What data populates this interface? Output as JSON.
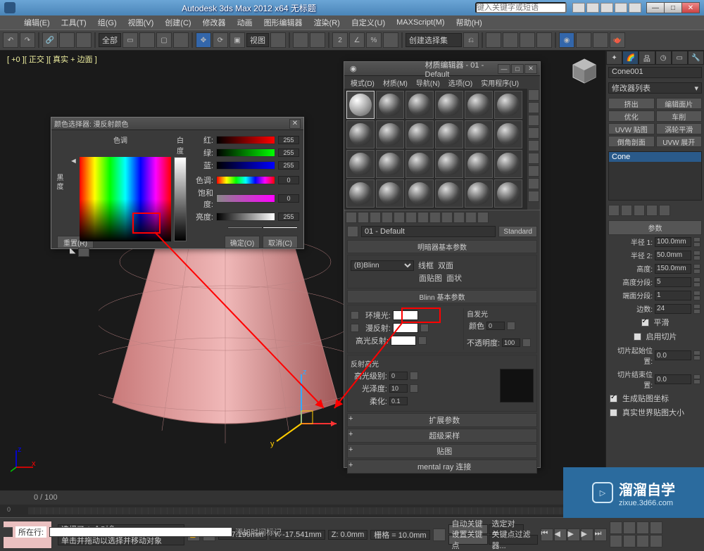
{
  "titlebar": {
    "title": "Autodesk 3ds Max  2012 x64     无标题",
    "search_ph": "键入关键字或短语"
  },
  "menu": [
    "编辑(E)",
    "工具(T)",
    "组(G)",
    "视图(V)",
    "创建(C)",
    "修改器",
    "动画",
    "图形编辑器",
    "渲染(R)",
    "自定义(U)",
    "MAXScript(M)",
    "帮助(H)"
  ],
  "toolbar": {
    "undo": "↶",
    "redo": "↷",
    "all": "全部",
    "view": "视图",
    "snapset": "创建选择集"
  },
  "viewport": {
    "label": "[ +0 ][ 正交 ][ 真实 + 边面 ]"
  },
  "cmd": {
    "name": "Cone001",
    "modlist": "修改器列表",
    "btns": [
      "挤出",
      "编辑面片",
      "优化",
      "车削",
      "UVW 贴图",
      "涡轮平滑",
      "倒角剖面",
      "UVW 展开"
    ],
    "stack": "Cone",
    "rollout": "参数",
    "radius1_l": "半径 1:",
    "radius1_v": "100.0mm",
    "radius2_l": "半径 2:",
    "radius2_v": "50.0mm",
    "height_l": "高度:",
    "height_v": "150.0mm",
    "hseg_l": "高度分段:",
    "hseg_v": "5",
    "cseg_l": "端面分段:",
    "cseg_v": "1",
    "sides_l": "边数:",
    "sides_v": "24",
    "smooth": "平滑",
    "slice": "启用切片",
    "slicefrom_l": "切片起始位置:",
    "slicefrom_v": "0.0",
    "sliceto_l": "切片结束位置:",
    "sliceto_v": "0.0",
    "genmap": "生成贴图坐标",
    "realworld": "真实世界贴图大小"
  },
  "mat": {
    "title": "材质编辑器 - 01 - Default",
    "menu": [
      "模式(D)",
      "材质(M)",
      "导航(N)",
      "选项(O)",
      "实用程序(U)"
    ],
    "name": "01 - Default",
    "type": "Standard",
    "r1": "明暗器基本参数",
    "shader": "(B)Blinn",
    "wire": "线框",
    "twoside": "双面",
    "facemap": "面贴图",
    "faceted": "面状",
    "r2": "Blinn 基本参数",
    "ambient": "环境光:",
    "diffuse": "漫反射:",
    "specc": "高光反射:",
    "selfillum": "自发光",
    "color": "颜色",
    "colorv": "0",
    "opacity": "不透明度:",
    "opacityv": "100",
    "r_spec": "反射高光",
    "speclvl": "高光级别:",
    "speclvlv": "0",
    "gloss": "光泽度:",
    "glossv": "10",
    "soften": "柔化:",
    "softenv": "0.1",
    "r3": "扩展参数",
    "r4": "超级采样",
    "r5": "贴图",
    "r6": "mental ray 连接"
  },
  "cp": {
    "title": "颜色选择器: 漫反射颜色",
    "hue": "色调",
    "white": "白度",
    "black": "黑 度",
    "r": "红:",
    "g": "绿:",
    "b": "蓝:",
    "h": "色调:",
    "s": "饱和度:",
    "v": "亮度:",
    "rv": "255",
    "gv": "255",
    "bv": "255",
    "hv": "0",
    "sv": "0",
    "vv": "255",
    "reset": "重置(R)",
    "ok": "确定(O)",
    "cancel": "取消(C)"
  },
  "status": {
    "sel": "选择了 1 个对象",
    "hint": "单击并拖动以选择并移动对象",
    "x": "X: 7.199mm",
    "y": "Y: -17.541mm",
    "z": "Z: 0.0mm",
    "grid": "栅格 = 10.0mm",
    "autokey": "自动关键点",
    "selset": "选定对象",
    "setkey": "设置关键点",
    "keyfilter": "关键点过滤器...",
    "loc": "所在行:",
    "addtime": "添加时间标记"
  },
  "timeline": {
    "range": "0 / 100"
  },
  "wm": {
    "t1": "溜溜自学",
    "t2": "zixue.3d66.com"
  }
}
